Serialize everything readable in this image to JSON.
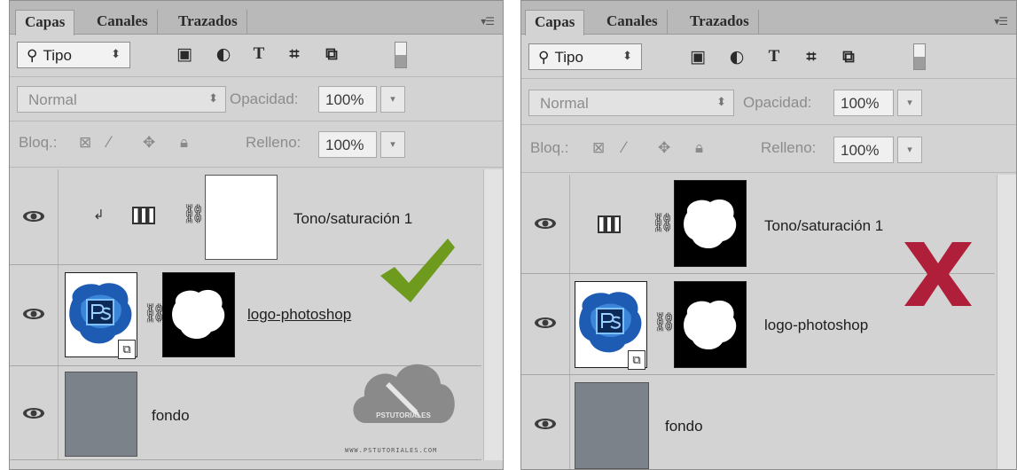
{
  "panels": [
    {
      "tabs": [
        "Capas",
        "Canales",
        "Trazados"
      ],
      "kind_filter": "Tipo",
      "blend_mode": "Normal",
      "opacity_label": "Opacidad:",
      "opacity_value": "100%",
      "lock_label": "Bloq.:",
      "fill_label": "Relleno:",
      "fill_value": "100%",
      "layers": [
        {
          "name": "Tono/saturación 1",
          "mask": "white"
        },
        {
          "name": "logo-photoshop",
          "mask": "black-with-white-shape"
        },
        {
          "name": "fondo"
        }
      ],
      "mark": "check",
      "mark_color": "#6e9a1e",
      "watermark_text": "WWW.PSTUTORIALES.COM"
    },
    {
      "tabs": [
        "Capas",
        "Canales",
        "Trazados"
      ],
      "kind_filter": "Tipo",
      "blend_mode": "Normal",
      "opacity_label": "Opacidad:",
      "opacity_value": "100%",
      "lock_label": "Bloq.:",
      "fill_label": "Relleno:",
      "fill_value": "100%",
      "layers": [
        {
          "name": "Tono/saturación 1",
          "mask": "black-with-white-shape"
        },
        {
          "name": "logo-photoshop",
          "mask": "black-with-white-shape"
        },
        {
          "name": "fondo"
        }
      ],
      "mark": "cross",
      "mark_color": "#b01f3a"
    }
  ]
}
